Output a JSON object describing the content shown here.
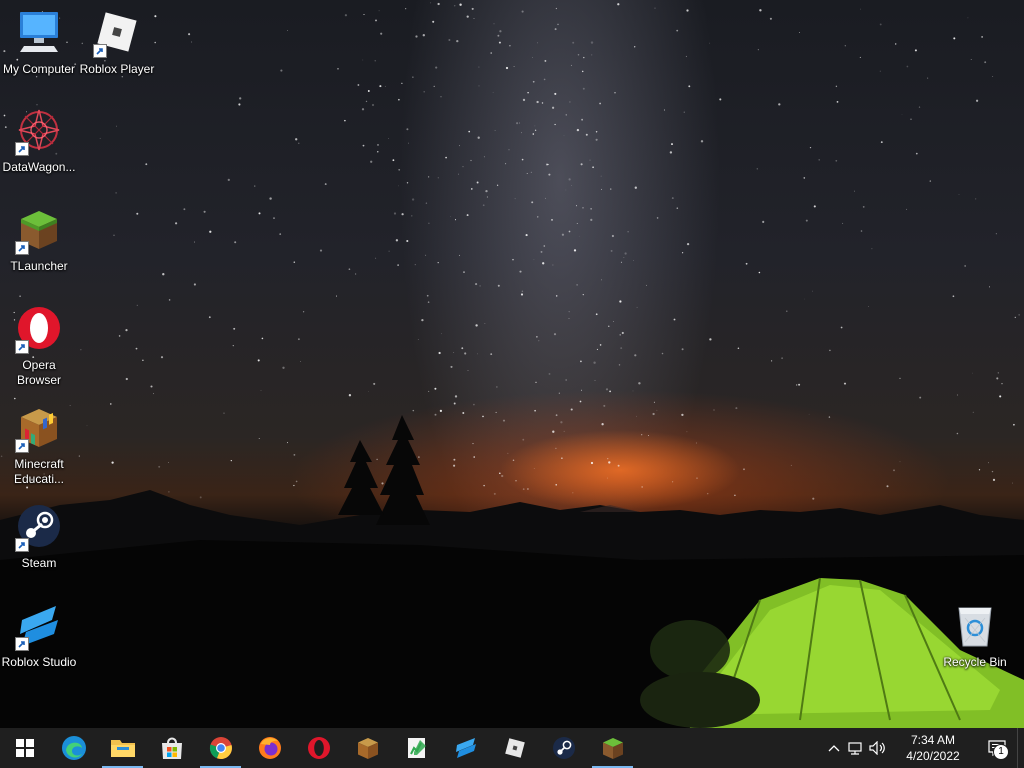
{
  "desktop": {
    "icons": [
      {
        "label": "My Computer",
        "icon": "computer-icon"
      },
      {
        "label": "Roblox Player",
        "icon": "roblox-player-icon"
      },
      {
        "label": "DataWagon...",
        "icon": "datawagon-icon"
      },
      {
        "label": "TLauncher",
        "icon": "tlauncher-icon"
      },
      {
        "label": "Opera\nBrowser",
        "icon": "opera-icon"
      },
      {
        "label": "Minecraft\nEducati...",
        "icon": "minecraft-education-icon"
      },
      {
        "label": "Steam",
        "icon": "steam-icon"
      },
      {
        "label": "Roblox Studio",
        "icon": "roblox-studio-icon"
      },
      {
        "label": "Recycle Bin",
        "icon": "recycle-bin-icon"
      }
    ]
  },
  "taskbar": {
    "pinned": [
      {
        "name": "start",
        "icon": "windows-start-icon"
      },
      {
        "name": "edge",
        "icon": "edge-icon"
      },
      {
        "name": "file-explorer",
        "icon": "folder-icon",
        "open": true
      },
      {
        "name": "microsoft-store",
        "icon": "store-icon"
      },
      {
        "name": "chrome",
        "icon": "chrome-icon",
        "open": true
      },
      {
        "name": "firefox",
        "icon": "firefox-icon"
      },
      {
        "name": "opera",
        "icon": "opera-icon"
      },
      {
        "name": "minecraft-education",
        "icon": "minecraft-education-icon"
      },
      {
        "name": "notepad-plus",
        "icon": "notepad-icon"
      },
      {
        "name": "roblox-studio",
        "icon": "roblox-studio-icon"
      },
      {
        "name": "roblox-player",
        "icon": "roblox-player-icon"
      },
      {
        "name": "steam",
        "icon": "steam-icon"
      },
      {
        "name": "tlauncher",
        "icon": "tlauncher-icon",
        "open": true
      }
    ],
    "tray": {
      "chevron": "^",
      "time": "7:34 AM",
      "date": "4/20/2022",
      "notification_count": "1"
    }
  },
  "colors": {
    "taskbar_bg": "#1f1f1f",
    "open_indicator": "#7ab8f0",
    "tent_green": "#8fd42a"
  }
}
